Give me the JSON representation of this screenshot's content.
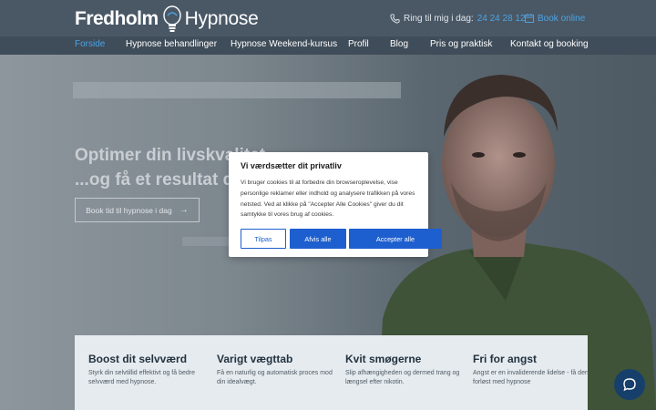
{
  "header": {
    "logo": {
      "name": "Fredholm",
      "sub": "Hypnose"
    },
    "call": {
      "label": "Ring til mig i dag:",
      "number": "24 24 28 12",
      "icon": "phone-icon"
    },
    "book_online": {
      "label": "Book online",
      "icon": "calendar-icon"
    }
  },
  "nav": {
    "items": [
      {
        "label": "Forside",
        "active": true
      },
      {
        "label": "Hypnose behandlinger"
      },
      {
        "label": "Hypnose Weekend-kursus"
      },
      {
        "label": "Profil"
      },
      {
        "label": "Blog"
      },
      {
        "label": "Pris og praktisk"
      },
      {
        "label": "Kontakt og booking"
      }
    ]
  },
  "hero": {
    "title_line1": "Optimer din livskvalitet",
    "title_line2": "...og få et resultat der",
    "cta": {
      "label": "Book tid til hypnose i dag",
      "icon": "arrow-right-icon"
    }
  },
  "cookie": {
    "title": "Vi værdsætter dit privatliv",
    "text": "Vi bruger cookies til at forbedre din browseroplevelse, vise personlige reklamer eller indhold og analysere trafikken på vores netsted. Ved at klikke på \"Accepter Alle Cookies\" giver du dit samtykke til vores brug af cookies.",
    "buttons": {
      "customize": "Tilpas",
      "reject": "Afvis alle",
      "accept": "Accepter alle"
    }
  },
  "cards": [
    {
      "title": "Boost dit selvværd",
      "text": "Styrk din selvtillid effektivt og få bedre selvværd med hypnose."
    },
    {
      "title": "Varigt vægttab",
      "text": "Få en naturlig og automatisk proces mod din idealvægt."
    },
    {
      "title": "Kvit smøgerne",
      "text": "Slip afhængigheden og dermed trang og længsel efter nikotin."
    },
    {
      "title": "Fri for angst",
      "text": "Angst er en invaliderende lidelse - få den forløst med hypnose"
    }
  ],
  "chat": {
    "icon": "chat-bubble-icon"
  },
  "colors": {
    "accent": "#4ba3e3",
    "button_blue": "#1e5fcf",
    "header_bg": "#4a5866"
  }
}
